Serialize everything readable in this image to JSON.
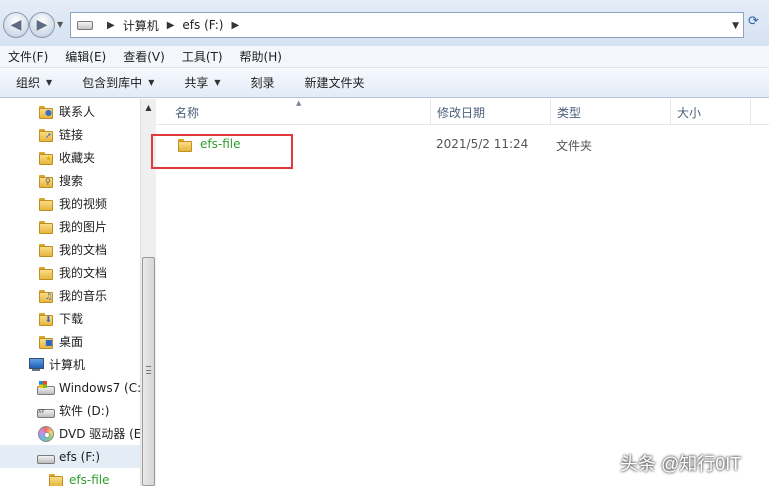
{
  "address": {
    "crumbs": [
      "计算机",
      "efs (F:)"
    ]
  },
  "menu": [
    "文件(F)",
    "编辑(E)",
    "查看(V)",
    "工具(T)",
    "帮助(H)"
  ],
  "toolbar": {
    "organize": "组织",
    "include_library": "包含到库中",
    "share": "共享",
    "burn": "刻录",
    "new_folder": "新建文件夹"
  },
  "nav": {
    "items": [
      {
        "label": "联系人",
        "icon": "contacts-folder-icon"
      },
      {
        "label": "链接",
        "icon": "links-folder-icon"
      },
      {
        "label": "收藏夹",
        "icon": "favorites-folder-icon"
      },
      {
        "label": "搜索",
        "icon": "searches-folder-icon"
      },
      {
        "label": "我的视频",
        "icon": "videos-folder-icon"
      },
      {
        "label": "我的图片",
        "icon": "pictures-folder-icon"
      },
      {
        "label": "我的文档",
        "icon": "documents-folder-icon"
      },
      {
        "label": "我的文档",
        "icon": "documents-folder-icon"
      },
      {
        "label": "我的音乐",
        "icon": "music-folder-icon"
      },
      {
        "label": "下载",
        "icon": "downloads-folder-icon"
      },
      {
        "label": "桌面",
        "icon": "desktop-folder-icon"
      },
      {
        "label": "计算机",
        "icon": "computer-icon"
      },
      {
        "label": "Windows7 (C:",
        "icon": "windows-drive-icon"
      },
      {
        "label": "软件 (D:)",
        "icon": "drive-icon"
      },
      {
        "label": "DVD 驱动器 (E",
        "icon": "dvd-drive-icon"
      },
      {
        "label": "efs (F:)",
        "icon": "drive-icon"
      },
      {
        "label": "efs-file",
        "icon": "folder-icon"
      }
    ]
  },
  "columns": {
    "name": "名称",
    "date": "修改日期",
    "type": "类型",
    "size": "大小"
  },
  "files": [
    {
      "name": "efs-file",
      "date": "2021/5/2 11:24",
      "type": "文件夹",
      "size": ""
    }
  ],
  "watermark": "头条 @知行0IT"
}
